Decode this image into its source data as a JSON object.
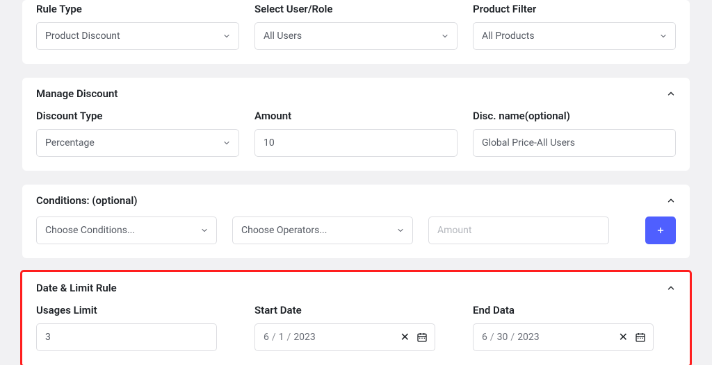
{
  "top": {
    "ruleType": {
      "label": "Rule Type",
      "value": "Product Discount"
    },
    "userRole": {
      "label": "Select User/Role",
      "value": "All Users"
    },
    "productFilter": {
      "label": "Product Filter",
      "value": "All Products"
    }
  },
  "manageDiscount": {
    "title": "Manage Discount",
    "discountType": {
      "label": "Discount Type",
      "value": "Percentage"
    },
    "amount": {
      "label": "Amount",
      "value": "10"
    },
    "discName": {
      "label": "Disc. name(optional)",
      "value": "Global Price-All Users"
    }
  },
  "conditions": {
    "title": "Conditions: (optional)",
    "chooseConditions": "Choose Conditions...",
    "chooseOperators": "Choose Operators...",
    "amountPlaceholder": "Amount"
  },
  "dateLimit": {
    "title": "Date & Limit Rule",
    "usagesLimit": {
      "label": "Usages Limit",
      "value": "3"
    },
    "startDate": {
      "label": "Start Date",
      "m": "6",
      "d": "1",
      "y": "2023"
    },
    "endDate": {
      "label": "End Data",
      "m": "6",
      "d": "30",
      "y": "2023"
    }
  }
}
